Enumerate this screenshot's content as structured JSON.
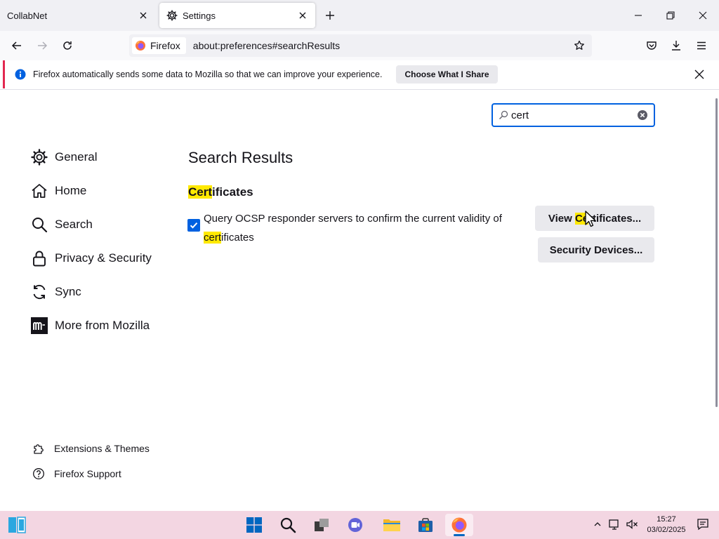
{
  "browser": {
    "tabs": [
      {
        "title": "CollabNet",
        "active": false
      },
      {
        "title": "Settings",
        "active": true
      }
    ],
    "identity_label": "Firefox",
    "url": "about:preferences#searchResults"
  },
  "notification": {
    "text": "Firefox automatically sends some data to Mozilla so that we can improve your experience.",
    "button_label": "Choose What I Share"
  },
  "search": {
    "value": "cert"
  },
  "sidebar": {
    "categories": [
      {
        "label": "General",
        "icon": "gear-icon"
      },
      {
        "label": "Home",
        "icon": "home-icon"
      },
      {
        "label": "Search",
        "icon": "search-icon"
      },
      {
        "label": "Privacy & Security",
        "icon": "lock-icon"
      },
      {
        "label": "Sync",
        "icon": "sync-icon"
      },
      {
        "label": "More from Mozilla",
        "icon": "mozilla-icon"
      }
    ],
    "footer": [
      {
        "label": "Extensions & Themes",
        "icon": "puzzle-icon"
      },
      {
        "label": "Firefox Support",
        "icon": "help-icon"
      }
    ]
  },
  "main": {
    "results_title": "Search Results",
    "section": {
      "title_highlight": "Cert",
      "title_rest": "ificates"
    },
    "ocsp": {
      "checked": true,
      "text_before": "Query OCSP responder servers to confirm the current validity of ",
      "text_highlight": "cert",
      "text_after": "ificates"
    },
    "buttons": {
      "view_before": "View ",
      "view_highlight": "Ce",
      "view_after": "rtificates...",
      "security_label": "Security Devices..."
    }
  },
  "taskbar": {
    "time": "15:27",
    "date": "03/02/2025"
  },
  "colors": {
    "accent": "#0061e0",
    "highlight": "#ffe900",
    "notice_stripe": "#e22850",
    "taskbar": "#f3d6e2"
  }
}
